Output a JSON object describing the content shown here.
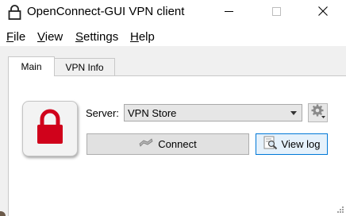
{
  "window": {
    "title": "OpenConnect-GUI VPN client",
    "controls": [
      "minimize-icon",
      "maximize-icon",
      "close-icon"
    ]
  },
  "menu": {
    "file": {
      "first": "F",
      "rest": "ile"
    },
    "view": {
      "first": "V",
      "rest": "iew"
    },
    "settings": {
      "first": "S",
      "rest": "ettings"
    },
    "help": {
      "first": "H",
      "rest": "elp"
    }
  },
  "tabs": [
    {
      "label": "Main",
      "active": true
    },
    {
      "label": "VPN Info",
      "active": false
    }
  ],
  "status": {
    "icon": "lock-icon",
    "color": "#d0021b"
  },
  "server": {
    "label": "Server:",
    "selected": "VPN Store"
  },
  "buttons": {
    "connect": "Connect",
    "view_log": "View log"
  },
  "colors": {
    "accent_border": "#0078d7",
    "lock_red": "#d0021b"
  }
}
